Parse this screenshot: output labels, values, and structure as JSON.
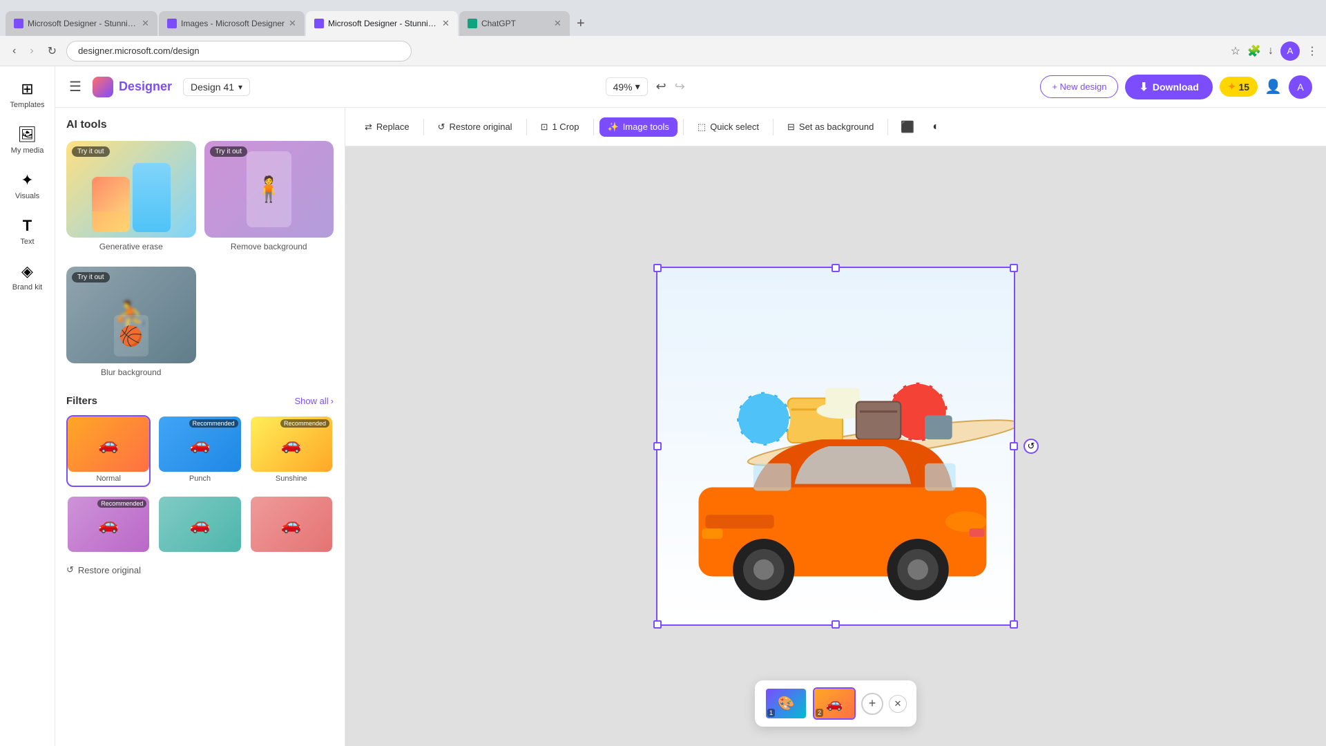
{
  "browser": {
    "tabs": [
      {
        "id": "t1",
        "label": "Microsoft Designer - Stunning...",
        "favicon_color": "#7c4dff",
        "active": false
      },
      {
        "id": "t2",
        "label": "Images - Microsoft Designer",
        "favicon_color": "#7c4dff",
        "active": false
      },
      {
        "id": "t3",
        "label": "Microsoft Designer - Stunning...",
        "favicon_color": "#7c4dff",
        "active": true
      },
      {
        "id": "t4",
        "label": "ChatGPT",
        "favicon_color": "#10a37f",
        "active": false
      }
    ],
    "url": "designer.microsoft.com/design"
  },
  "header": {
    "logo_text": "Designer",
    "design_name": "Design 41",
    "zoom_level": "49%",
    "new_design_label": "+ New design",
    "download_label": "Download",
    "coin_count": "15",
    "hamburger_icon": "☰"
  },
  "toolbar": {
    "replace_label": "Replace",
    "restore_label": "Restore original",
    "crop_label": "1 Crop",
    "image_tools_label": "Image tools",
    "quick_select_label": "Quick select",
    "set_as_bg_label": "Set as background"
  },
  "left_panel": {
    "title": "AI tools",
    "tools": [
      {
        "id": "generative-erase",
        "label": "Generative erase",
        "has_try_it": true
      },
      {
        "id": "remove-background",
        "label": "Remove background",
        "has_try_it": true
      },
      {
        "id": "blur-background",
        "label": "Blur background",
        "has_try_it": true
      }
    ],
    "filters_title": "Filters",
    "show_all_label": "Show all",
    "filters": [
      {
        "id": "normal",
        "label": "Normal",
        "selected": true,
        "recommended": false
      },
      {
        "id": "punch",
        "label": "Punch",
        "selected": false,
        "recommended": true
      },
      {
        "id": "sunshine",
        "label": "Sunshine",
        "selected": false,
        "recommended": true
      }
    ],
    "restore_label": "Restore original",
    "try_it_text": "Try it out"
  },
  "rail": {
    "items": [
      {
        "id": "templates",
        "icon": "⊞",
        "label": "Templates"
      },
      {
        "id": "my-media",
        "icon": "🖼",
        "label": "My media"
      },
      {
        "id": "visuals",
        "icon": "✦",
        "label": "Visuals"
      },
      {
        "id": "text",
        "icon": "T",
        "label": "Text"
      },
      {
        "id": "brand",
        "icon": "◈",
        "label": "Brand kit"
      }
    ]
  },
  "canvas": {
    "image_description": "Orange car with luggage on roof",
    "page_count": 2,
    "active_page": 2
  },
  "page_thumbnails": {
    "pages": [
      {
        "num": "1",
        "active": false
      },
      {
        "num": "2",
        "active": true
      }
    ],
    "add_label": "+"
  }
}
